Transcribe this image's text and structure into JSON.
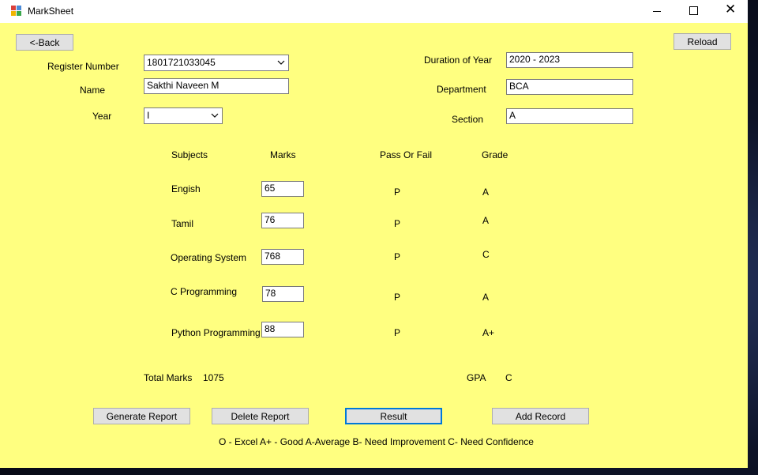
{
  "window": {
    "title": "MarkSheet"
  },
  "buttons": {
    "back": "<-Back",
    "reload": "Reload",
    "generate": "Generate Report",
    "delete": "Delete Report",
    "result": "Result",
    "add": "Add Record"
  },
  "form": {
    "register_number_label": "Register Number",
    "register_number": "1801721033045",
    "name_label": "Name",
    "name": "Sakthi Naveen M",
    "year_label": "Year",
    "year": "I",
    "duration_label": "Duration of Year",
    "duration": "2020 - 2023",
    "department_label": "Department",
    "department": "BCA",
    "section_label": "Section",
    "section": "A"
  },
  "table": {
    "headers": {
      "subjects": "Subjects",
      "marks": "Marks",
      "pass_fail": "Pass Or Fail",
      "grade": "Grade"
    },
    "rows": [
      {
        "subject": "Engish",
        "mark": "65",
        "result": "P",
        "grade": "A"
      },
      {
        "subject": "Tamil",
        "mark": "76",
        "result": "P",
        "grade": "A"
      },
      {
        "subject": "Operating System",
        "mark": "768",
        "result": "P",
        "grade": "C"
      },
      {
        "subject": "C Programming",
        "mark": "78",
        "result": "P",
        "grade": "A"
      },
      {
        "subject": "Python Programming",
        "mark": "88",
        "result": "P",
        "grade": "A+"
      }
    ]
  },
  "summary": {
    "total_label": "Total Marks",
    "total": "1075",
    "gpa_label": "GPA",
    "gpa": "C"
  },
  "legend": "O - Excel A+ - Good A-Average B- Need Improvement C- Need Confidence",
  "colors": {
    "form_background": "#ffff80",
    "focus_border": "#0078d7"
  }
}
